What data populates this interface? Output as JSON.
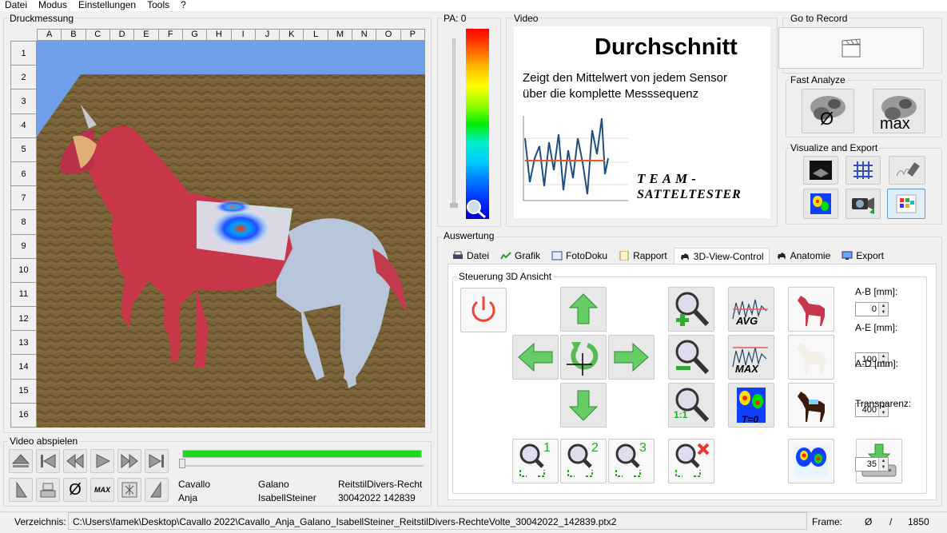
{
  "menu": [
    "Datei",
    "Modus",
    "Einstellungen",
    "Tools",
    "?"
  ],
  "druckmessung": {
    "title": "Druckmessung",
    "columns": [
      "A",
      "B",
      "C",
      "D",
      "E",
      "F",
      "G",
      "H",
      "I",
      "J",
      "K",
      "L",
      "M",
      "N",
      "O",
      "P"
    ],
    "rows": [
      "1",
      "2",
      "3",
      "4",
      "5",
      "6",
      "7",
      "8",
      "9",
      "10",
      "11",
      "12",
      "13",
      "14",
      "15",
      "16"
    ]
  },
  "pa": {
    "label": "PA: 0",
    "level": 0
  },
  "video": {
    "title": "Video",
    "heading": "Durchschnitt",
    "desc1": "Zeigt den Mittelwert von jedem Sensor",
    "desc2": "über die komplette Messsequenz",
    "logo1": "TEAM-",
    "logo2": "SATTELTESTER"
  },
  "goto": {
    "title": "Go to Record"
  },
  "fast": {
    "title": "Fast Analyze",
    "avg_label": "Ø",
    "max_label": "max"
  },
  "visualize": {
    "title": "Visualize and Export"
  },
  "auswertung": {
    "title": "Auswertung",
    "tabs": [
      "Datei",
      "Grafik",
      "FotoDoku",
      "Rapport",
      "3D-View-Control",
      "Anatomie",
      "Export"
    ],
    "active_tab": "3D-View-Control",
    "steuerung_title": "Steuerung 3D Ansicht",
    "zoom_labels": [
      "1",
      "2",
      "3"
    ],
    "zoom_reset_label": "1:1",
    "avg_label": "AVG",
    "max_label": "MAX",
    "t0_label": "T=0",
    "fields": [
      {
        "label": "A-B [mm]:",
        "value": "0"
      },
      {
        "label": "A-E [mm]:",
        "value": "100"
      },
      {
        "label": "A-D [mm]:",
        "value": "400"
      },
      {
        "label": "Transparenz:",
        "value": "35"
      }
    ]
  },
  "player": {
    "title": "Video abspielen",
    "progress": 1.0,
    "info": [
      [
        "Cavallo",
        "Galano",
        "ReitstilDivers-Recht"
      ],
      [
        "Anja",
        "IsabellSteiner",
        "30042022 142839"
      ]
    ],
    "max_label": "MAX",
    "avg_label": "Ø"
  },
  "status": {
    "dir_label": "Verzeichnis:",
    "path": "C:\\Users\\famek\\Desktop\\Cavallo 2022\\Cavallo_Anja_Galano_IsabellSteiner_ReitstilDivers-RechteVolte_30042022_142839.ptx2",
    "frame_label": "Frame:",
    "frame_value": "Ø",
    "sep": "/",
    "frame_total": "1850"
  },
  "colors": {
    "accent_green": "#1fd81f",
    "sky": "#6f9fe8",
    "ground": "#6b5530"
  }
}
